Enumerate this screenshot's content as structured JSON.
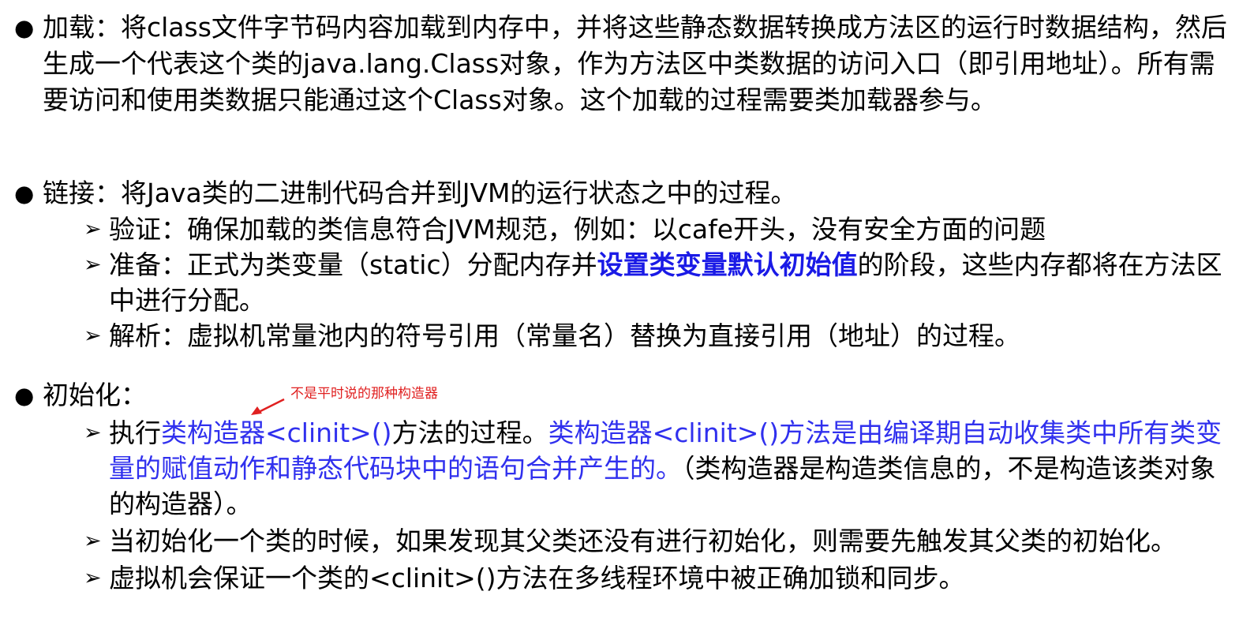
{
  "sections": [
    {
      "bullet": "●",
      "label": "加载：",
      "text": "将class文件字节码内容加载到内存中，并将这些静态数据转换成方法区的运行时数据结构，然后生成一个代表这个类的java.lang.Class对象，作为方法区中类数据的访问入口（即引用地址）。所有需要访问和使用类数据只能通过这个Class对象。这个加载的过程需要类加载器参与。"
    },
    {
      "bullet": "●",
      "label": "链接：",
      "text": "将Java类的二进制代码合并到JVM的运行状态之中的过程。",
      "items": [
        {
          "marker": "➢",
          "text": "验证：确保加载的类信息符合JVM规范，例如：以cafe开头，没有安全方面的问题"
        },
        {
          "marker": "➢",
          "text_before": "准备：正式为类变量（static）分配内存并",
          "highlight": "设置类变量默认初始值",
          "text_after": "的阶段，这些内存都将在方法区中进行分配。"
        },
        {
          "marker": "➢",
          "text": "解析：虚拟机常量池内的符号引用（常量名）替换为直接引用（地址）的过程。"
        }
      ]
    },
    {
      "bullet": "●",
      "label": "初始化：",
      "annotation": "不是平时说的那种构造器",
      "items": [
        {
          "marker": "➢",
          "text_before": "执行",
          "highlight1": "类构造器<clinit>()",
          "text_middle": "方法的过程。",
          "highlight2": "类构造器<clinit>()方法是由编译期自动收集类中所有类变量的赋值动作和静态代码块中的语句合并产生的。",
          "text_after": "（类构造器是构造类信息的，不是构造该类对象的构造器）。"
        },
        {
          "marker": "➢",
          "text": "当初始化一个类的时候，如果发现其父类还没有进行初始化，则需要先触发其父类的初始化。"
        },
        {
          "marker": "➢",
          "text": "虚拟机会保证一个类的<clinit>()方法在多线程环境中被正确加锁和同步。"
        }
      ]
    }
  ],
  "colors": {
    "text": "#000000",
    "highlight_blue_bold": "#1a1ae6",
    "highlight_blue": "#3030ee",
    "annotation_red": "#e02020"
  }
}
